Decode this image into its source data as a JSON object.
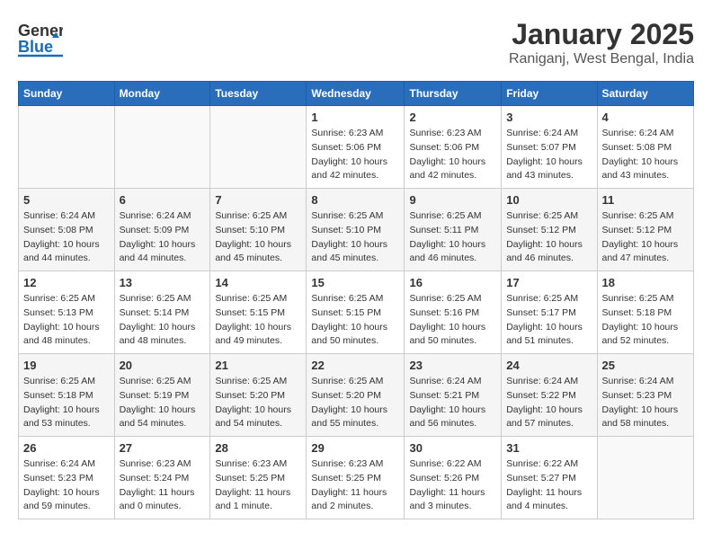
{
  "app": {
    "logo_general": "General",
    "logo_blue": "Blue",
    "title": "January 2025",
    "subtitle": "Raniganj, West Bengal, India"
  },
  "calendar": {
    "headers": [
      "Sunday",
      "Monday",
      "Tuesday",
      "Wednesday",
      "Thursday",
      "Friday",
      "Saturday"
    ],
    "weeks": [
      [
        {
          "day": "",
          "lines": []
        },
        {
          "day": "",
          "lines": []
        },
        {
          "day": "",
          "lines": []
        },
        {
          "day": "1",
          "lines": [
            "Sunrise: 6:23 AM",
            "Sunset: 5:06 PM",
            "Daylight: 10 hours",
            "and 42 minutes."
          ]
        },
        {
          "day": "2",
          "lines": [
            "Sunrise: 6:23 AM",
            "Sunset: 5:06 PM",
            "Daylight: 10 hours",
            "and 42 minutes."
          ]
        },
        {
          "day": "3",
          "lines": [
            "Sunrise: 6:24 AM",
            "Sunset: 5:07 PM",
            "Daylight: 10 hours",
            "and 43 minutes."
          ]
        },
        {
          "day": "4",
          "lines": [
            "Sunrise: 6:24 AM",
            "Sunset: 5:08 PM",
            "Daylight: 10 hours",
            "and 43 minutes."
          ]
        }
      ],
      [
        {
          "day": "5",
          "lines": [
            "Sunrise: 6:24 AM",
            "Sunset: 5:08 PM",
            "Daylight: 10 hours",
            "and 44 minutes."
          ]
        },
        {
          "day": "6",
          "lines": [
            "Sunrise: 6:24 AM",
            "Sunset: 5:09 PM",
            "Daylight: 10 hours",
            "and 44 minutes."
          ]
        },
        {
          "day": "7",
          "lines": [
            "Sunrise: 6:25 AM",
            "Sunset: 5:10 PM",
            "Daylight: 10 hours",
            "and 45 minutes."
          ]
        },
        {
          "day": "8",
          "lines": [
            "Sunrise: 6:25 AM",
            "Sunset: 5:10 PM",
            "Daylight: 10 hours",
            "and 45 minutes."
          ]
        },
        {
          "day": "9",
          "lines": [
            "Sunrise: 6:25 AM",
            "Sunset: 5:11 PM",
            "Daylight: 10 hours",
            "and 46 minutes."
          ]
        },
        {
          "day": "10",
          "lines": [
            "Sunrise: 6:25 AM",
            "Sunset: 5:12 PM",
            "Daylight: 10 hours",
            "and 46 minutes."
          ]
        },
        {
          "day": "11",
          "lines": [
            "Sunrise: 6:25 AM",
            "Sunset: 5:12 PM",
            "Daylight: 10 hours",
            "and 47 minutes."
          ]
        }
      ],
      [
        {
          "day": "12",
          "lines": [
            "Sunrise: 6:25 AM",
            "Sunset: 5:13 PM",
            "Daylight: 10 hours",
            "and 48 minutes."
          ]
        },
        {
          "day": "13",
          "lines": [
            "Sunrise: 6:25 AM",
            "Sunset: 5:14 PM",
            "Daylight: 10 hours",
            "and 48 minutes."
          ]
        },
        {
          "day": "14",
          "lines": [
            "Sunrise: 6:25 AM",
            "Sunset: 5:15 PM",
            "Daylight: 10 hours",
            "and 49 minutes."
          ]
        },
        {
          "day": "15",
          "lines": [
            "Sunrise: 6:25 AM",
            "Sunset: 5:15 PM",
            "Daylight: 10 hours",
            "and 50 minutes."
          ]
        },
        {
          "day": "16",
          "lines": [
            "Sunrise: 6:25 AM",
            "Sunset: 5:16 PM",
            "Daylight: 10 hours",
            "and 50 minutes."
          ]
        },
        {
          "day": "17",
          "lines": [
            "Sunrise: 6:25 AM",
            "Sunset: 5:17 PM",
            "Daylight: 10 hours",
            "and 51 minutes."
          ]
        },
        {
          "day": "18",
          "lines": [
            "Sunrise: 6:25 AM",
            "Sunset: 5:18 PM",
            "Daylight: 10 hours",
            "and 52 minutes."
          ]
        }
      ],
      [
        {
          "day": "19",
          "lines": [
            "Sunrise: 6:25 AM",
            "Sunset: 5:18 PM",
            "Daylight: 10 hours",
            "and 53 minutes."
          ]
        },
        {
          "day": "20",
          "lines": [
            "Sunrise: 6:25 AM",
            "Sunset: 5:19 PM",
            "Daylight: 10 hours",
            "and 54 minutes."
          ]
        },
        {
          "day": "21",
          "lines": [
            "Sunrise: 6:25 AM",
            "Sunset: 5:20 PM",
            "Daylight: 10 hours",
            "and 54 minutes."
          ]
        },
        {
          "day": "22",
          "lines": [
            "Sunrise: 6:25 AM",
            "Sunset: 5:20 PM",
            "Daylight: 10 hours",
            "and 55 minutes."
          ]
        },
        {
          "day": "23",
          "lines": [
            "Sunrise: 6:24 AM",
            "Sunset: 5:21 PM",
            "Daylight: 10 hours",
            "and 56 minutes."
          ]
        },
        {
          "day": "24",
          "lines": [
            "Sunrise: 6:24 AM",
            "Sunset: 5:22 PM",
            "Daylight: 10 hours",
            "and 57 minutes."
          ]
        },
        {
          "day": "25",
          "lines": [
            "Sunrise: 6:24 AM",
            "Sunset: 5:23 PM",
            "Daylight: 10 hours",
            "and 58 minutes."
          ]
        }
      ],
      [
        {
          "day": "26",
          "lines": [
            "Sunrise: 6:24 AM",
            "Sunset: 5:23 PM",
            "Daylight: 10 hours",
            "and 59 minutes."
          ]
        },
        {
          "day": "27",
          "lines": [
            "Sunrise: 6:23 AM",
            "Sunset: 5:24 PM",
            "Daylight: 11 hours",
            "and 0 minutes."
          ]
        },
        {
          "day": "28",
          "lines": [
            "Sunrise: 6:23 AM",
            "Sunset: 5:25 PM",
            "Daylight: 11 hours",
            "and 1 minute."
          ]
        },
        {
          "day": "29",
          "lines": [
            "Sunrise: 6:23 AM",
            "Sunset: 5:25 PM",
            "Daylight: 11 hours",
            "and 2 minutes."
          ]
        },
        {
          "day": "30",
          "lines": [
            "Sunrise: 6:22 AM",
            "Sunset: 5:26 PM",
            "Daylight: 11 hours",
            "and 3 minutes."
          ]
        },
        {
          "day": "31",
          "lines": [
            "Sunrise: 6:22 AM",
            "Sunset: 5:27 PM",
            "Daylight: 11 hours",
            "and 4 minutes."
          ]
        },
        {
          "day": "",
          "lines": []
        }
      ]
    ]
  }
}
